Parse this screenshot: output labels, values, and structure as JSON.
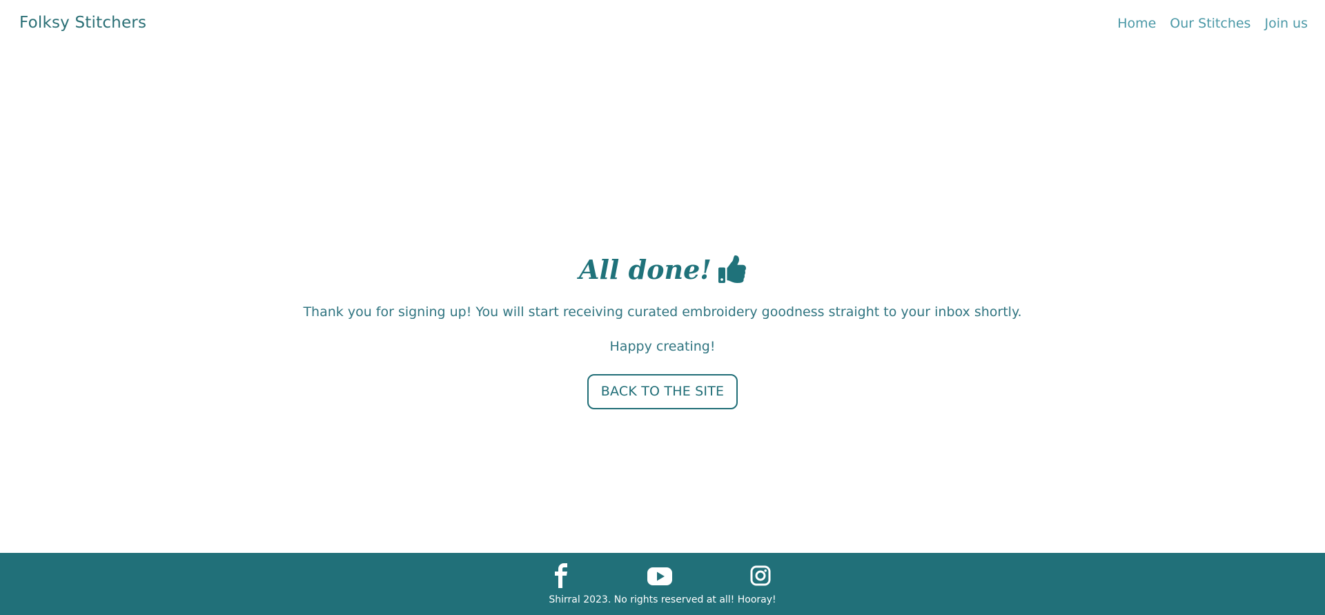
{
  "header": {
    "brand": "Folksy Stitchers",
    "nav": [
      "Home",
      "Our Stitches",
      "Join us"
    ]
  },
  "main": {
    "heading": "All done!",
    "heading_icon": "thumbs-up-icon",
    "message": "Thank you for signing up! You will start receiving curated embroidery goodness straight to your inbox shortly.",
    "sub_message": "Happy creating!",
    "button_label": "BACK TO THE SITE"
  },
  "footer": {
    "social": [
      "facebook-icon",
      "youtube-icon",
      "instagram-icon"
    ],
    "copyright": "Shirral 2023. No rights reserved at all! Hooray!"
  },
  "colors": {
    "primary": "#217079",
    "nav_link": "#4a98a6",
    "background": "#ffffff"
  }
}
